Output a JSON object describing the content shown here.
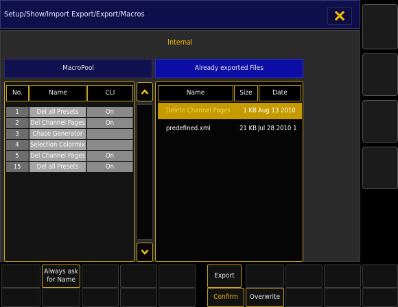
{
  "title": "Setup/Show/Import Export/Export/Macros",
  "section_label": "Internal",
  "macro_pool": {
    "header": "MacroPool",
    "columns": [
      "No.",
      "Name",
      "CLI"
    ],
    "rows": [
      {
        "no": "1",
        "name": "Del all Presets",
        "cli": "On"
      },
      {
        "no": "2",
        "name": "Del Channel Pages",
        "cli": "On"
      },
      {
        "no": "3",
        "name": "Chase Generator",
        "cli": ""
      },
      {
        "no": "4",
        "name": "Selection Colormix",
        "cli": ""
      },
      {
        "no": "5",
        "name": "Del Channel Pages",
        "cli": "On"
      },
      {
        "no": "15",
        "name": "Del all Presets",
        "cli": "On"
      }
    ]
  },
  "exported": {
    "header": "Already exported Files",
    "columns": [
      "Name",
      "Size",
      "Date"
    ],
    "rows": [
      {
        "name": "Delete Channel Pages",
        "size": "1 KB",
        "date": "Aug 13 2010",
        "selected": true
      },
      {
        "name": "predefined.xml",
        "size": "21 KB",
        "date": "Jul 28 2010 1",
        "selected": false
      }
    ]
  },
  "buttons": {
    "always_ask": "Always ask for Name",
    "export": "Export",
    "confirm": "Confirm",
    "overwrite": "Overwrite"
  },
  "colors": {
    "accent": "#f2b90a",
    "title_bg": "#0f0f4c",
    "selected_row": "#c69a00",
    "export_header": "#0c0ea6"
  },
  "icons": {
    "close": "close-x-icon",
    "scroll_up": "chevron-up-icon",
    "scroll_down": "chevron-down-icon"
  }
}
